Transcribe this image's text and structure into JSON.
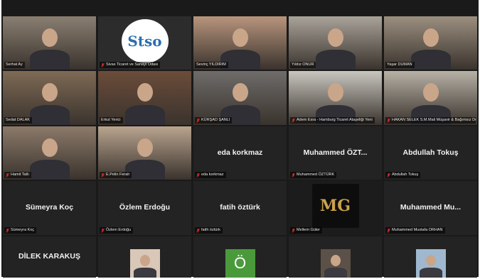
{
  "participants": [
    {
      "name": "Serhat Ay",
      "type": "video",
      "bg": "#8a7f72"
    },
    {
      "name": "Sivas Ticaret ve Sanayi Odası",
      "type": "logo",
      "logo_text": "Stso",
      "bg": "#2c2c2c"
    },
    {
      "name": "Sevinç YILDIRIM",
      "type": "video",
      "bg": "#b8957d"
    },
    {
      "name": "Yıldız ONUR",
      "type": "video",
      "bg": "#a9a39a"
    },
    {
      "name": "Yaşar DUMAN",
      "type": "video",
      "bg": "#9b8f80"
    },
    {
      "name": "Sedat DALAK",
      "type": "video",
      "bg": "#7e6a55",
      "active": true
    },
    {
      "name": "Erkut Yerici",
      "type": "video",
      "bg": "#6b4c3a"
    },
    {
      "name": "KÜRŞAD ŞANLI",
      "type": "video",
      "bg": "#6e6c6a"
    },
    {
      "name": "Adem Esra - Hamburg Ticaret Ataşeliği Yeni",
      "type": "video",
      "bg": "#c9c6c0"
    },
    {
      "name": "HAKAN SELEK S.M.Mali Müşavir & Bağımsız Denetçi",
      "type": "video",
      "bg": "#b7b1a6"
    },
    {
      "name": "Hamit Tatlı",
      "type": "video",
      "bg": "#8c7a6a"
    },
    {
      "name": "E.Pelin Ferah",
      "type": "video",
      "bg": "#b9a48f"
    },
    {
      "name": "eda korkmaz",
      "type": "name",
      "display": "eda korkmaz"
    },
    {
      "name": "Muhammed ÖZTÜRK",
      "type": "name",
      "display": "Muhammed  ÖZT..."
    },
    {
      "name": "Abdullah Tokuş",
      "type": "name",
      "display": "Abdullah Tokuş"
    },
    {
      "name": "Sümeyra Koç",
      "type": "name",
      "display": "Sümeyra Koç"
    },
    {
      "name": "Özlem Erdoğu",
      "type": "name",
      "display": "Özlem Erdoğu"
    },
    {
      "name": "fatih öztürk",
      "type": "name",
      "display": "fatih öztürk"
    },
    {
      "name": "Meltem Güler",
      "type": "logo",
      "logo_text": "MG",
      "bg": "#1c1c1c"
    },
    {
      "name": "Muhammed Mustafa ORHAN",
      "type": "name",
      "display": "Muhammed  Mu..."
    },
    {
      "name": "DİLEK KARAKUŞ",
      "type": "name",
      "display": "DİLEK KARAKUŞ"
    },
    {
      "name": "",
      "type": "thumb",
      "thumb_bg": "#d9c7b8"
    },
    {
      "name": "",
      "type": "letter",
      "letter": "Ö",
      "letter_bg": "#4a9a3c"
    },
    {
      "name": "",
      "type": "thumb",
      "thumb_bg": "#5b5148"
    },
    {
      "name": "",
      "type": "thumb",
      "thumb_bg": "#9fb8cf"
    }
  ],
  "colors": {
    "background": "#1a1a1a",
    "tile": "#232323",
    "active_border": "#c8d23a",
    "muted_mic": "#e0302a"
  }
}
